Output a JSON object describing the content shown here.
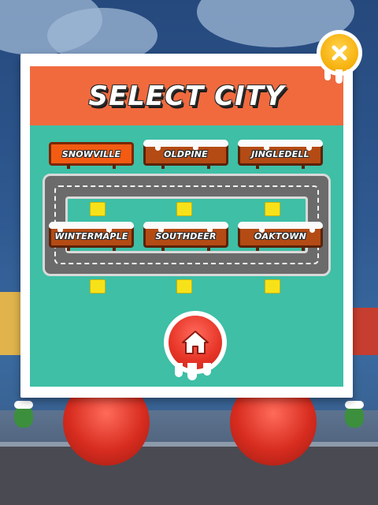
{
  "popup": {
    "title": "SELECT CITY"
  },
  "cities": [
    {
      "label": "SNOWVILLE",
      "selected": true
    },
    {
      "label": "OLDPINE",
      "selected": false
    },
    {
      "label": "JINGLEDELL",
      "selected": false
    },
    {
      "label": "WINTERMAPLE",
      "selected": false
    },
    {
      "label": "SOUTHDEER",
      "selected": false
    },
    {
      "label": "OAKTOWN",
      "selected": false
    }
  ],
  "buttons": {
    "home_icon": "home-icon",
    "close_icon": "close-icon"
  },
  "colors": {
    "header": "#f06a3e",
    "panel": "#3ebfa6",
    "sign": "#b44b14",
    "sign_selected": "#f35b12",
    "close": "#f7b20f",
    "home": "#e63426",
    "marker": "#f7e21a"
  }
}
